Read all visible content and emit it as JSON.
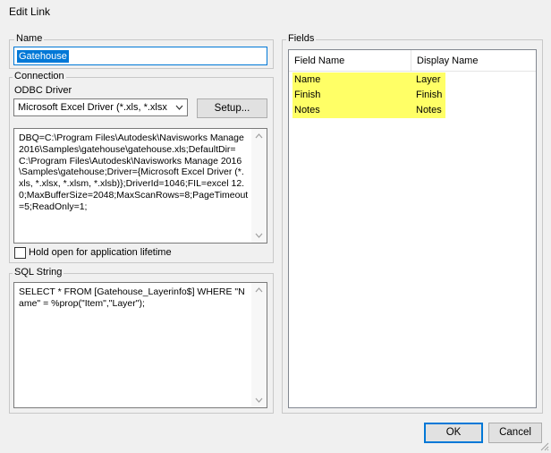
{
  "window": {
    "title": "Edit Link"
  },
  "name_group": {
    "legend": "Name",
    "value": "Gatehouse"
  },
  "connection_group": {
    "legend": "Connection",
    "driver_label": "ODBC Driver",
    "driver_value": "Microsoft Excel Driver (*.xls, *.xlsx",
    "setup_label": "Setup...",
    "connection_string": "DBQ=C:\\Program Files\\Autodesk\\Navisworks Manage 2016\\Samples\\gatehouse\\gatehouse.xls;DefaultDir=C:\\Program Files\\Autodesk\\Navisworks Manage 2016\\Samples\\gatehouse;Driver={Microsoft Excel Driver (*.xls, *.xlsx, *.xlsm, *.xlsb)};DriverId=1046;FIL=excel 12.0;MaxBufferSize=2048;MaxScanRows=8;PageTimeout=5;ReadOnly=1;",
    "hold_open_label": "Hold open for application lifetime",
    "hold_open_checked": false
  },
  "sql_group": {
    "legend": "SQL String",
    "sql": "SELECT * FROM [Gatehouse_Layerinfo$] WHERE \"Name\" = %prop(\"Item\",\"Layer\");"
  },
  "fields_group": {
    "legend": "Fields",
    "columns": [
      "Field Name",
      "Display Name"
    ],
    "rows": [
      {
        "field": "Name",
        "display": "Layer"
      },
      {
        "field": "Finish",
        "display": "Finish"
      },
      {
        "field": "Notes",
        "display": "Notes"
      }
    ],
    "highlight_color": "#ffff66"
  },
  "footer": {
    "ok_label": "OK",
    "cancel_label": "Cancel"
  },
  "icons": {
    "combo": "chevron-down-icon",
    "scroll_up": "scroll-up-icon",
    "scroll_down": "scroll-down-icon",
    "grip": "resize-grip-icon"
  }
}
